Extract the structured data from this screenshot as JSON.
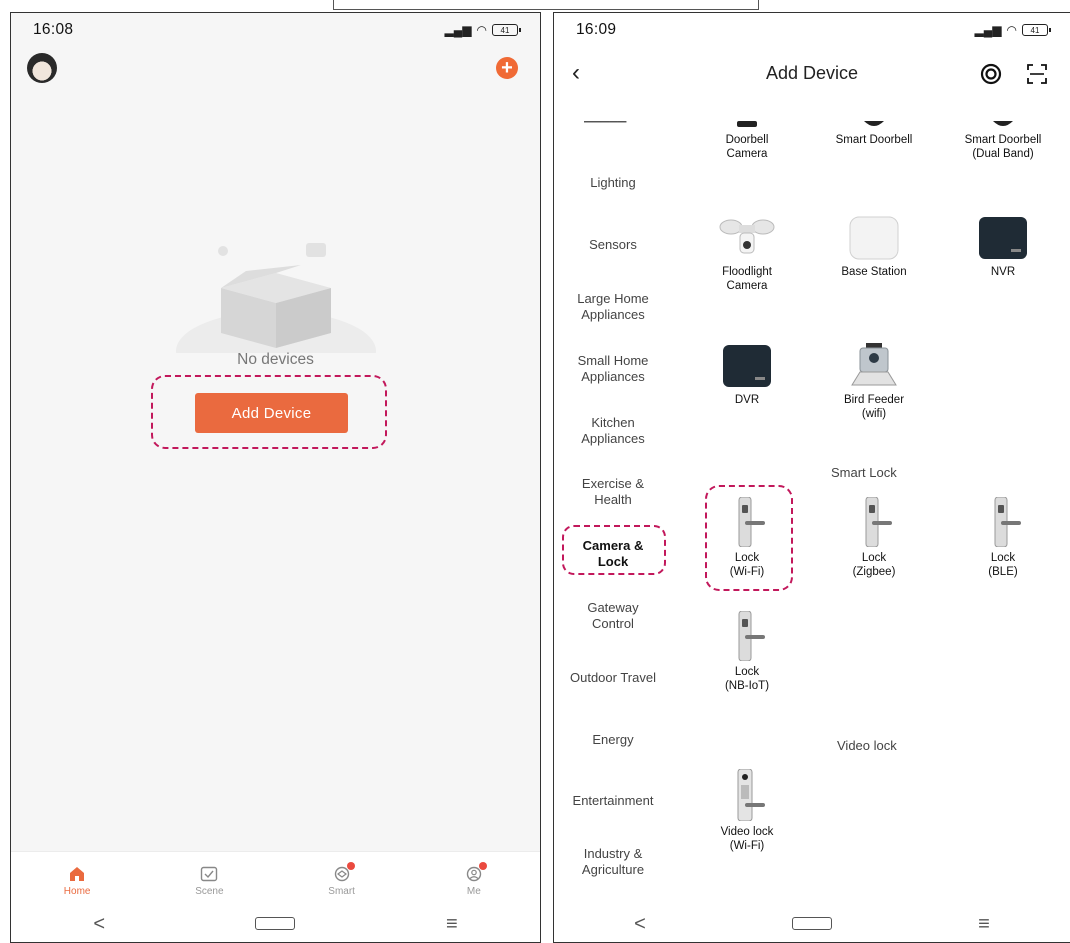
{
  "left": {
    "status": {
      "time": "16:08",
      "battery": "41"
    },
    "empty_text": "No devices",
    "add_device_button": "Add Device",
    "tabs": [
      {
        "label": "Home",
        "icon": "home-icon",
        "active": true
      },
      {
        "label": "Scene",
        "icon": "scene-icon",
        "active": false
      },
      {
        "label": "Smart",
        "icon": "smart-icon",
        "active": false
      },
      {
        "label": "Me",
        "icon": "me-icon",
        "active": false
      }
    ]
  },
  "right": {
    "status": {
      "time": "16:09",
      "battery": "41"
    },
    "title": "Add Device",
    "categories": [
      "Lighting",
      "Sensors",
      "Large Home\nAppliances",
      "Small Home\nAppliances",
      "Kitchen\nAppliances",
      "Exercise &\nHealth",
      "Camera &\nLock",
      "Gateway\nControl",
      "Outdoor Travel",
      "Energy",
      "Entertainment",
      "Industry &\nAgriculture"
    ],
    "doorbells": [
      "Doorbell\nCamera",
      "Smart Doorbell",
      "Smart Doorbell\n(Dual Band)"
    ],
    "cameras": [
      "Floodlight\nCamera",
      "Base Station",
      "NVR",
      "DVR",
      "Bird Feeder\n(wifi)"
    ],
    "smart_lock_title": "Smart Lock",
    "locks": [
      "Lock\n(Wi-Fi)",
      "Lock\n(Zigbee)",
      "Lock\n(BLE)",
      "Lock\n(NB-IoT)"
    ],
    "video_lock_title": "Video lock",
    "video_locks": [
      "Video lock\n(Wi-Fi)"
    ]
  },
  "colors": {
    "accent": "#ea6a3f",
    "highlight_dash": "#c2185b"
  }
}
